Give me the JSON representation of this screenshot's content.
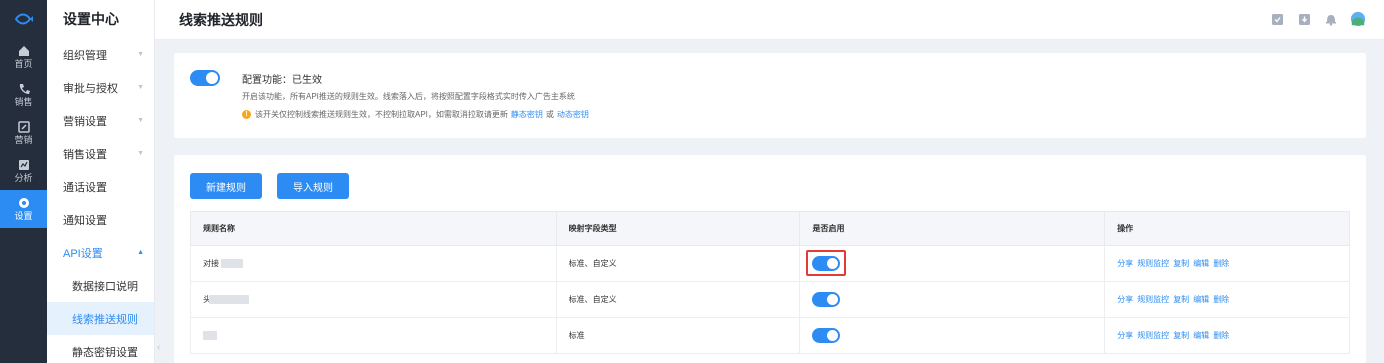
{
  "rail": {
    "items": [
      {
        "label": "首页",
        "icon": "home-icon"
      },
      {
        "label": "销售",
        "icon": "phone-icon"
      },
      {
        "label": "营销",
        "icon": "edit-icon"
      },
      {
        "label": "分析",
        "icon": "chart-icon"
      },
      {
        "label": "设置",
        "icon": "gear-icon"
      }
    ]
  },
  "menu": {
    "title": "设置中心",
    "items": [
      {
        "label": "组织管理"
      },
      {
        "label": "审批与授权"
      },
      {
        "label": "营销设置"
      },
      {
        "label": "销售设置"
      },
      {
        "label": "通话设置"
      },
      {
        "label": "通知设置"
      },
      {
        "label": "API设置"
      }
    ],
    "sub_items": [
      {
        "label": "数据接口说明"
      },
      {
        "label": "线索推送规则"
      },
      {
        "label": "静态密钥设置"
      }
    ]
  },
  "header": {
    "title": "线索推送规则"
  },
  "config": {
    "status": "配置功能：已生效",
    "desc": "开启该功能，所有API推送的规则生效。线索落入后，将按照配置字段格式实时传入广告主系统",
    "warn_text": "该开关仅控制线索推送规则生效，不控制拉取API，如需取消拉取请更新",
    "link_static": "静态密钥",
    "or_text": "或",
    "link_dynamic": "动态密钥",
    "enabled": true
  },
  "toolbar": {
    "new_rule": "新建规则",
    "import_rule": "导入规则"
  },
  "table": {
    "headers": [
      "规则名称",
      "映射字段类型",
      "是否启用",
      "操作"
    ],
    "rows": [
      {
        "name": "对接",
        "type": "标准、自定义",
        "enabled": true
      },
      {
        "name": "头条  动",
        "type": "标准、自定义",
        "enabled": true
      },
      {
        "name": "",
        "type": "标准",
        "enabled": true
      }
    ],
    "actions": [
      "分享",
      "规则监控",
      "复制",
      "编辑",
      "删除"
    ]
  },
  "colors": {
    "accent": "#2c8cf4",
    "rail_bg": "#252e3d",
    "highlight": "#e53935",
    "warn": "#f5a623"
  }
}
